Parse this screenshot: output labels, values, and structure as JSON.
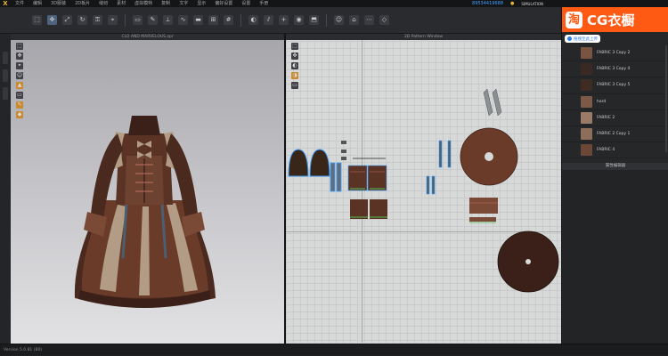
{
  "app": {
    "logo": "X",
    "menu": [
      "文件",
      "编辑",
      "3D服装",
      "2D板片",
      "缝纫",
      "素材",
      "虚拟模特",
      "复制",
      "文字",
      "显示",
      "偏好设置",
      "设置",
      "手册"
    ],
    "user_id": "89534419688",
    "simulation_label": "SIMULATION"
  },
  "toolbar": {
    "icons": [
      "select-icon",
      "move-icon",
      "scale-icon",
      "rotate-icon",
      "lock-icon",
      "pin-icon",
      "measure-icon",
      "brush-icon",
      "fold-icon",
      "sew-icon",
      "tape-icon",
      "arrange-icon",
      "grid-icon",
      "shade-icon",
      "split-icon",
      "plus-icon",
      "button-icon",
      "mask-icon",
      "avatar-icon",
      "cloth-icon",
      "stitch-icon",
      "pattern-icon"
    ]
  },
  "viewport3d": {
    "title": "CLO AND MARVELOUS.zpr"
  },
  "pattern_window": {
    "title": "2D Pattern Window"
  },
  "watermark": {
    "icon_char": "淘",
    "brand": "CG衣橱",
    "upload_label": "拖拽至此上传"
  },
  "fabrics": [
    {
      "name": "FABRIC 3 Copy 2",
      "color": "#7a5443"
    },
    {
      "name": "FABRIC 3 Copy 4",
      "color": "#3a2824"
    },
    {
      "name": "FABRIC 3 Copy 5",
      "color": "#3e2b22"
    },
    {
      "name": "hard",
      "color": "#7d5a47"
    },
    {
      "name": "FABRIC 2",
      "color": "#9a7a68"
    },
    {
      "name": "FABRIC 2 Copy 1",
      "color": "#8d6e5d"
    },
    {
      "name": "FABRIC 4",
      "color": "#6a4737"
    }
  ],
  "properties": {
    "header": "属性编辑器"
  },
  "status": {
    "text": "Version 5.0.81 (B0)"
  },
  "colors": {
    "accent": "#3fa1ff",
    "brand": "#ff5a14",
    "dress_brown": "#6b3b2a",
    "dress_beige": "#b29c85"
  }
}
